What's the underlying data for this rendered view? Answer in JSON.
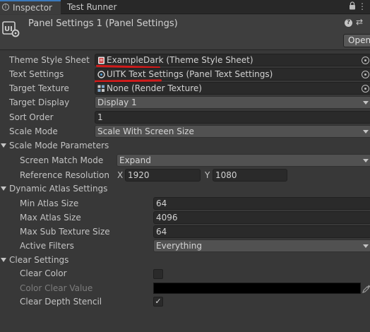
{
  "tabs": {
    "inspector": "Inspector",
    "test_runner": "Test Runner"
  },
  "header": {
    "title": "Panel Settings 1 (Panel Settings)",
    "open_button": "Open"
  },
  "fields": {
    "theme_style_sheet": {
      "label": "Theme Style Sheet",
      "value": "ExampleDark (Theme Style Sheet)"
    },
    "text_settings": {
      "label": "Text Settings",
      "value": "UITK Text Settings (Panel Text Settings)"
    },
    "target_texture": {
      "label": "Target Texture",
      "value": "None (Render Texture)"
    },
    "target_display": {
      "label": "Target Display",
      "value": "Display 1"
    },
    "sort_order": {
      "label": "Sort Order",
      "value": "1"
    },
    "scale_mode": {
      "label": "Scale Mode",
      "value": "Scale With Screen Size"
    }
  },
  "scale_mode_parameters": {
    "title": "Scale Mode Parameters",
    "screen_match_mode": {
      "label": "Screen Match Mode",
      "value": "Expand"
    },
    "reference_resolution": {
      "label": "Reference Resolution",
      "x_label": "X",
      "x_value": "1920",
      "y_label": "Y",
      "y_value": "1080"
    }
  },
  "dynamic_atlas": {
    "title": "Dynamic Atlas Settings",
    "min_atlas_size": {
      "label": "Min Atlas Size",
      "value": "64"
    },
    "max_atlas_size": {
      "label": "Max Atlas Size",
      "value": "4096"
    },
    "max_sub_texture_size": {
      "label": "Max Sub Texture Size",
      "value": "64"
    },
    "active_filters": {
      "label": "Active Filters",
      "value": "Everything"
    }
  },
  "clear_settings": {
    "title": "Clear Settings",
    "clear_color": {
      "label": "Clear Color",
      "checked": false
    },
    "color_clear_value": {
      "label": "Color Clear Value",
      "color": "#000000"
    },
    "clear_depth_stencil": {
      "label": "Clear Depth Stencil",
      "checked": true,
      "check_glyph": "✓"
    }
  },
  "colors": {
    "accent": "#3a79bb",
    "annotation_underline": "#d21b1b",
    "background": "#383838"
  }
}
